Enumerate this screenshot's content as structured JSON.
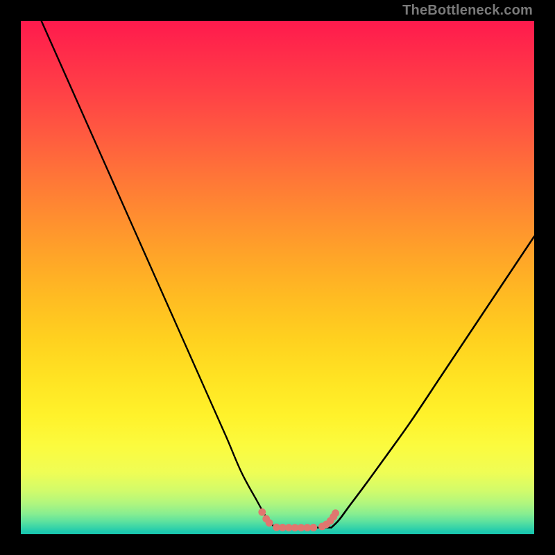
{
  "watermark": "TheBottleneck.com",
  "colors": {
    "background": "#000000",
    "curve": "#000000",
    "marker": "#e0766f",
    "gradient_top": "#ff1a4d",
    "gradient_bottom": "#17c6af"
  },
  "chart_data": {
    "type": "line",
    "title": "",
    "xlabel": "",
    "ylabel": "",
    "xlim": [
      0,
      100
    ],
    "ylim": [
      0,
      100
    ],
    "grid": false,
    "legend": false,
    "annotations": [
      "TheBottleneck.com"
    ],
    "series": [
      {
        "name": "left-curve",
        "x": [
          4,
          8,
          12,
          16,
          20,
          24,
          28,
          32,
          36,
          40,
          43,
          46,
          48,
          49.5
        ],
        "y": [
          100,
          91,
          82,
          73,
          64,
          55,
          46,
          37,
          28,
          19,
          12,
          6.5,
          3,
          1.3
        ]
      },
      {
        "name": "right-curve",
        "x": [
          60.5,
          62,
          64,
          67,
          71,
          76,
          82,
          88,
          94,
          100
        ],
        "y": [
          1.3,
          2.8,
          5.5,
          9.5,
          15,
          22,
          31,
          40,
          49,
          58
        ]
      },
      {
        "name": "floor-segment",
        "x": [
          49.5,
          60.5
        ],
        "y": [
          1.3,
          1.3
        ]
      }
    ],
    "marker_points": {
      "name": "bottom-markers",
      "x": [
        47.0,
        47.8,
        48.4,
        49.8,
        51.0,
        52.2,
        53.4,
        54.6,
        55.8,
        57.0,
        58.7,
        59.5,
        60.3,
        60.9,
        61.3
      ],
      "y": [
        4.3,
        3.0,
        2.2,
        1.35,
        1.3,
        1.28,
        1.27,
        1.27,
        1.28,
        1.3,
        1.5,
        1.9,
        2.6,
        3.4,
        4.1
      ]
    }
  }
}
